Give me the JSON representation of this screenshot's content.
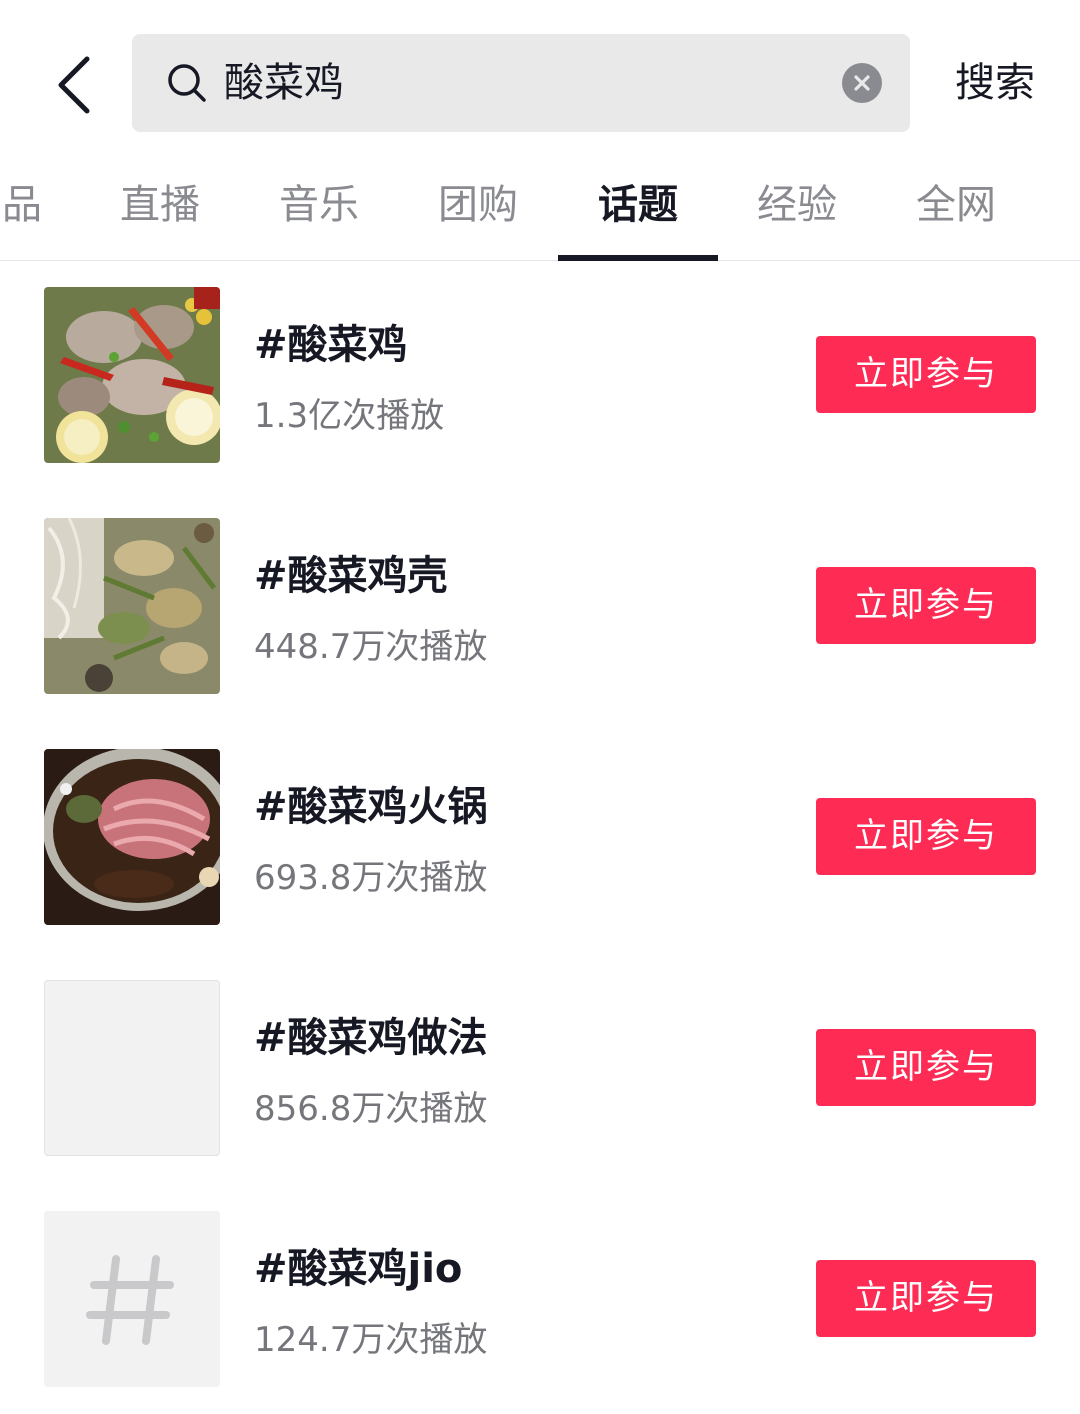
{
  "search": {
    "query": "酸菜鸡",
    "submit_label": "搜索"
  },
  "tabs": [
    {
      "label": "品",
      "active": false
    },
    {
      "label": "直播",
      "active": false
    },
    {
      "label": "音乐",
      "active": false
    },
    {
      "label": "团购",
      "active": false
    },
    {
      "label": "话题",
      "active": true
    },
    {
      "label": "经验",
      "active": false
    },
    {
      "label": "全网",
      "active": false
    }
  ],
  "topics": [
    {
      "title": "#酸菜鸡",
      "plays": "1.3亿次播放",
      "button": "立即参与",
      "thumbnail": "food-photo-chicken"
    },
    {
      "title": "#酸菜鸡壳",
      "plays": "448.7万次播放",
      "button": "立即参与",
      "thumbnail": "food-photo-noodles"
    },
    {
      "title": "#酸菜鸡火锅",
      "plays": "693.8万次播放",
      "button": "立即参与",
      "thumbnail": "food-photo-hotpot"
    },
    {
      "title": "#酸菜鸡做法",
      "plays": "856.8万次播放",
      "button": "立即参与",
      "thumbnail": "blank"
    },
    {
      "title": "#酸菜鸡jio",
      "plays": "124.7万次播放",
      "button": "立即参与",
      "thumbnail": "hashtag-icon"
    }
  ],
  "colors": {
    "accent": "#fe2c55",
    "text_primary": "#161823",
    "text_secondary": "#75767b",
    "search_bg": "#e9e9ea"
  }
}
